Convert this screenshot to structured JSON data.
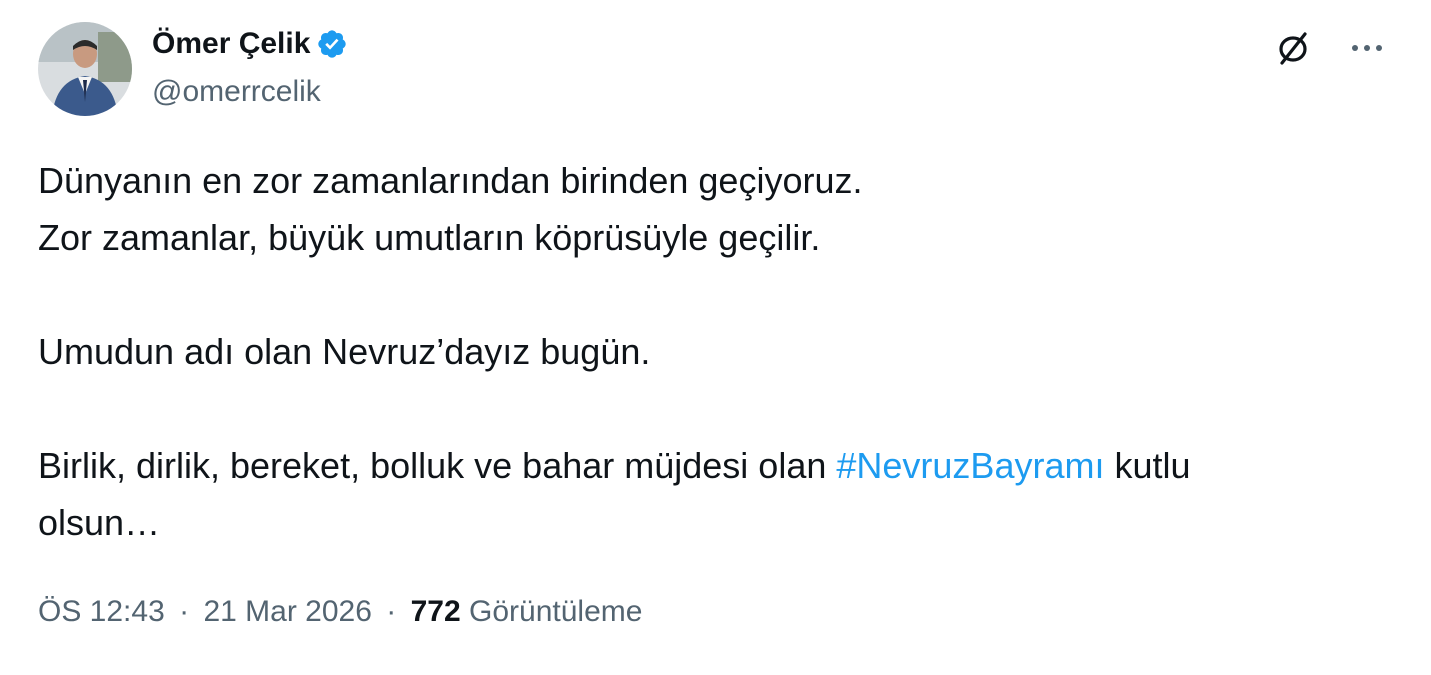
{
  "author": {
    "display_name": "Ömer Çelik",
    "handle": "@omerrcelik",
    "verified": true,
    "verified_color": "#1d9bf0"
  },
  "actions": {
    "grok_icon": "grok-icon",
    "more_icon": "more-icon"
  },
  "tweet": {
    "line1": "Dünyanın en zor zamanlarından birinden geçiyoruz.",
    "line2": "Zor zamanlar, büyük umutların köprüsüyle geçilir.",
    "line3": "Umudun adı olan Nevruz’dayız bugün.",
    "line4_prefix": "Birlik, dirlik, bereket, bolluk ve bahar müjdesi olan ",
    "hashtag": "#NevruzBayramı",
    "line4_suffix": " kutlu",
    "line5": "olsun…",
    "hashtag_color": "#1d9bf0"
  },
  "meta": {
    "time": "ÖS 12:43",
    "separator": "·",
    "date": "21 Mar 2026",
    "views_count": "772",
    "views_label": "Görüntüleme"
  }
}
